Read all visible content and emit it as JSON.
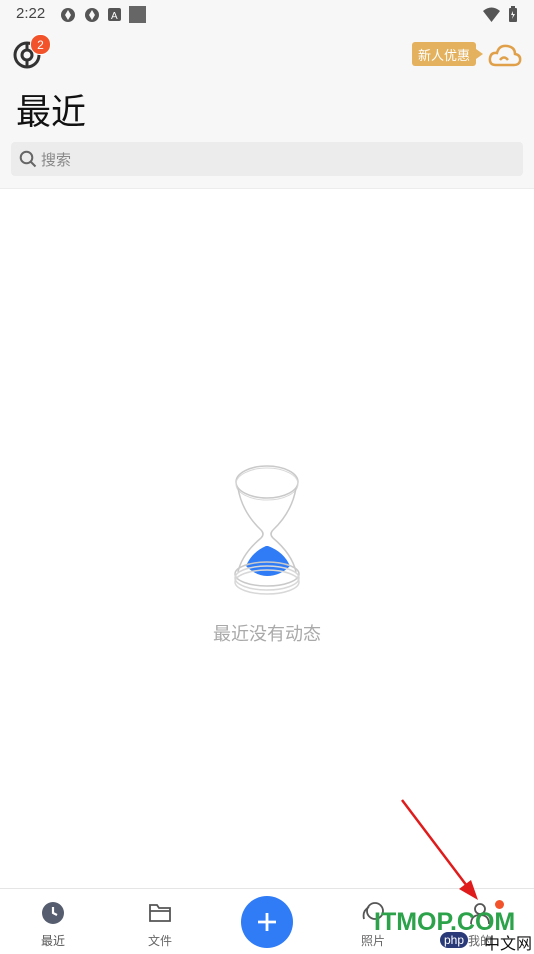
{
  "status_bar": {
    "time": "2:22",
    "left_icons": [
      "sync-icon",
      "sync-icon",
      "font-icon",
      "square-icon"
    ],
    "right_icons": [
      "wifi-icon",
      "battery-icon"
    ]
  },
  "header": {
    "sync_badge_count": "2",
    "promo_label": "新人优惠",
    "title": "最近"
  },
  "search": {
    "placeholder": "搜索"
  },
  "empty_state": {
    "message": "最近没有动态",
    "icon": "hourglass-icon"
  },
  "bottom_nav": {
    "items": [
      {
        "label": "最近",
        "icon": "clock-icon"
      },
      {
        "label": "文件",
        "icon": "folder-icon"
      },
      {
        "label": "照片",
        "icon": "photo-icon"
      },
      {
        "label": "我的",
        "icon": "user-icon"
      }
    ],
    "fab_icon": "plus-icon"
  },
  "watermark": {
    "main": "ITMOP.COM",
    "php": "php",
    "cn": "中文网"
  },
  "colors": {
    "accent": "#2f7cf6",
    "badge": "#f3532a",
    "promo": "#e4b25f",
    "annotation_arrow": "#e01b1b"
  }
}
